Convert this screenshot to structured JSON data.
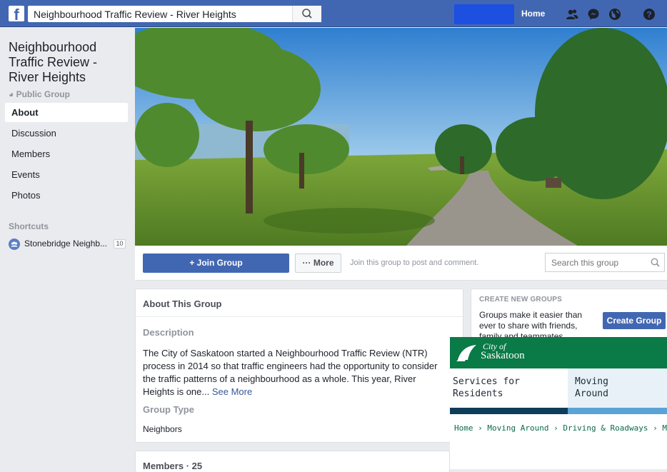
{
  "topbar": {
    "logo_letter": "f",
    "search_value": "Neighbourhood Traffic Review - River Heights",
    "home_label": "Home",
    "icons": [
      "search-icon",
      "friends-icon",
      "messenger-icon",
      "globe-icon",
      "help-icon"
    ],
    "colors": {
      "bar": "#4267b2",
      "highlight": "#1d4fe0"
    }
  },
  "group": {
    "title": "Neighbourhood Traffic Review - River Heights",
    "privacy": "Public Group"
  },
  "nav": {
    "items": [
      {
        "label": "About",
        "active": true
      },
      {
        "label": "Discussion"
      },
      {
        "label": "Members"
      },
      {
        "label": "Events"
      },
      {
        "label": "Photos"
      }
    ]
  },
  "shortcuts": {
    "label": "Shortcuts",
    "items": [
      {
        "label": "Stonebridge Neighb...",
        "count": "10"
      }
    ]
  },
  "actions": {
    "join_label": "+ Join Group",
    "more_label": "··· More",
    "hint": "Join this group to post and comment.",
    "search_placeholder": "Search this group"
  },
  "about": {
    "heading": "About This Group",
    "description_label": "Description",
    "description": "The City of Saskatoon started a Neighbourhood Traffic Review (NTR) process in 2014 so that traffic engineers had the opportunity to consider the traffic patterns of a neighbourhood as a whole. This year, River Heights is one...",
    "see_more": "See More",
    "group_type_label": "Group Type",
    "group_type": "Neighbors"
  },
  "members": {
    "heading": "Members · 25"
  },
  "create_groups": {
    "heading": "CREATE NEW GROUPS",
    "text": "Groups make it easier than ever to share with friends, family and teammates.",
    "button": "Create Group"
  },
  "saskatoon": {
    "city_of": "City of",
    "name": "Saskatoon",
    "tab1_line1": "Services for",
    "tab1_line2": "Residents",
    "tab2_line1": "Moving",
    "tab2_line2": "Around",
    "breadcrumb": "Home › Moving Around › Driving & Roadways › Managing Traf",
    "colors": {
      "green": "#0a7a47",
      "navy": "#0e3d5a",
      "light_blue": "#5aa3d6"
    }
  }
}
